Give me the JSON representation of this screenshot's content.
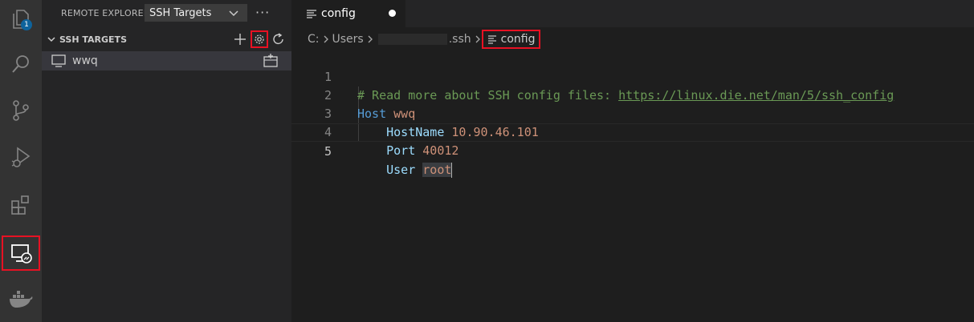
{
  "activity_bar": {
    "explorer_badge": "1",
    "items": [
      "files-icon",
      "search-icon",
      "source-control-icon",
      "run-debug-icon",
      "extensions-icon",
      "remote-explorer-icon",
      "docker-icon"
    ]
  },
  "sidebar": {
    "title": "REMOTE EXPLORER",
    "view_select": "SSH Targets",
    "more": "···",
    "section_title": "SSH TARGETS",
    "targets": [
      {
        "label": "wwq"
      }
    ]
  },
  "tab": {
    "label": "config"
  },
  "breadcrumbs": {
    "drive": "C:",
    "users": "Users",
    "ssh": ".ssh",
    "file": "config"
  },
  "editor": {
    "lines": [
      {
        "num": "1",
        "comment": "# Read more about SSH config files: ",
        "link": "https://linux.die.net/man/5/ssh_config"
      },
      {
        "num": "2",
        "keyword": "Host",
        "value": "wwq"
      },
      {
        "num": "3",
        "indent": "    ",
        "key": "HostName",
        "value": "10.90.46.101"
      },
      {
        "num": "4",
        "indent": "    ",
        "key": "Port",
        "value": "40012"
      },
      {
        "num": "5",
        "indent": "    ",
        "key": "User",
        "value": "root"
      }
    ]
  },
  "colors": {
    "highlight_box": "#e81123",
    "comment": "#6a9955",
    "keyword": "#569cd6",
    "key": "#9cdcfe",
    "value": "#ce9178"
  }
}
